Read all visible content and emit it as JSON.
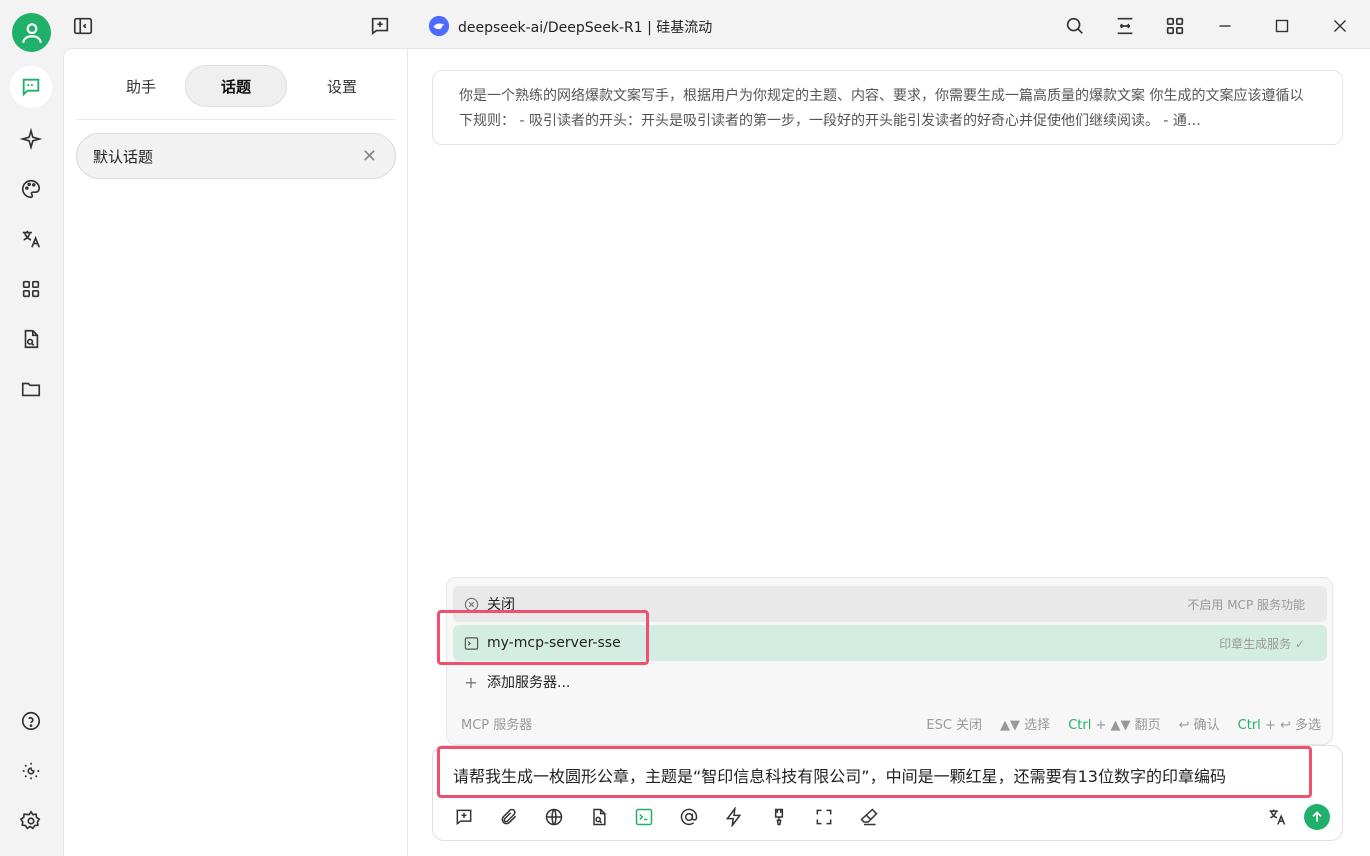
{
  "window": {
    "title": "deepseek-ai/DeepSeek-R1 | 硅基流动"
  },
  "sidebar": {
    "tabs": [
      {
        "label": "助手"
      },
      {
        "label": "话题"
      },
      {
        "label": "设置"
      }
    ],
    "active_tab": "话题",
    "topics": [
      {
        "label": "默认话题"
      }
    ]
  },
  "system_prompt": {
    "text": "你是一个熟练的网络爆款文案写手，根据用户为你规定的主题、内容、要求，你需要生成一篇高质量的爆款文案 你生成的文案应该遵循以下规则： - 吸引读者的开头：开头是吸引读者的第一步，一段好的开头能引发读者的好奇心并促使他们继续阅读。 - 通…"
  },
  "mcp_menu": {
    "items": [
      {
        "label": "关闭",
        "desc": "不启用 MCP 服务功能"
      },
      {
        "label": "my-mcp-server-sse",
        "desc": "印章生成服务 ✓"
      },
      {
        "label": "添加服务器..."
      }
    ],
    "footer_title": "MCP 服务器",
    "hints": {
      "esc": "ESC 关闭",
      "select": "▲▼ 选择",
      "page_key": "Ctrl",
      "page": "+ ▲▼ 翻页",
      "confirm": "↩ 确认",
      "multi_key": "Ctrl",
      "multi": "+ ↩ 多选"
    }
  },
  "input": {
    "value": "请帮我生成一枚圆形公章，主题是“智印信息科技有限公司”，中间是一颗红星，还需要有13位数字的印章编码"
  },
  "colors": {
    "accent": "#21b06a",
    "highlight": "#f0506e"
  }
}
